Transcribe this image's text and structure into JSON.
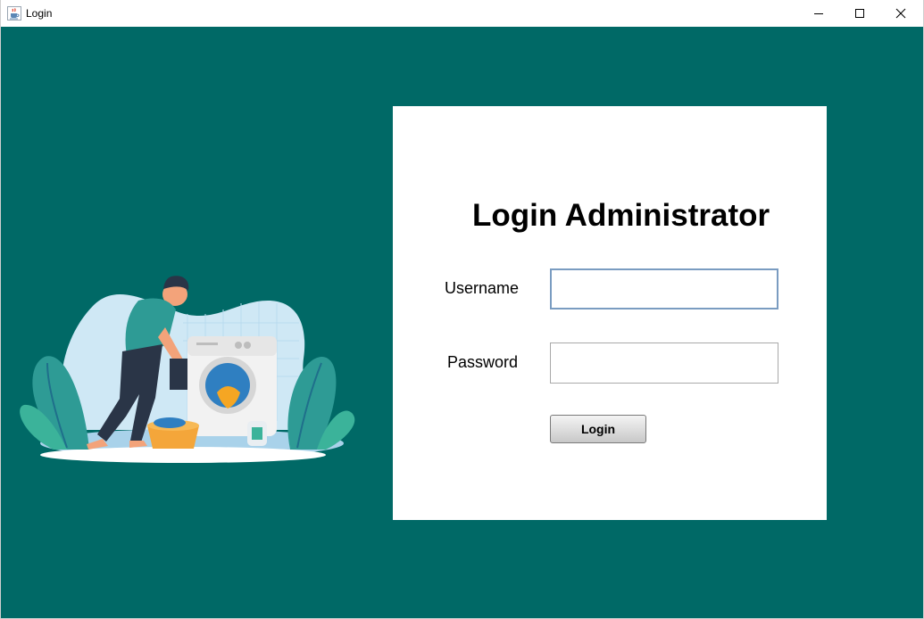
{
  "window": {
    "title": "Login",
    "icon": "java-cup-icon",
    "controls": [
      "minimize-icon",
      "maximize-icon",
      "close-icon"
    ]
  },
  "colors": {
    "background": "#006966",
    "panel": "#ffffff",
    "input_focus_border": "#7a9cc1"
  },
  "illustration": {
    "description_icon": "laundry-illustration-icon"
  },
  "form": {
    "heading": "Login Administrator",
    "username_label": "Username",
    "username_value": "",
    "password_label": "Password",
    "password_value": "",
    "login_button": "Login"
  }
}
